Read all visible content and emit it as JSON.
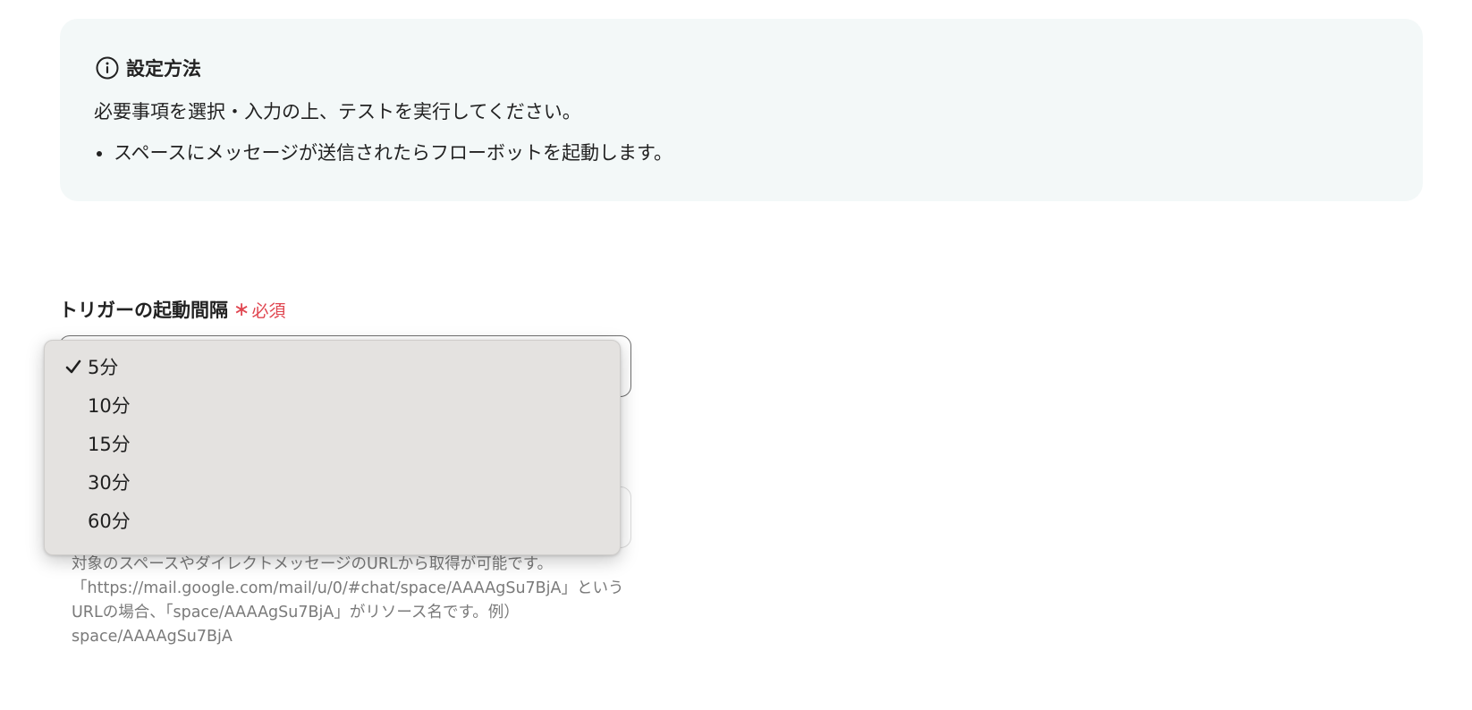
{
  "info": {
    "title": "設定方法",
    "description": "必要事項を選択・入力の上、テストを実行してください。",
    "bullets": [
      "スペースにメッセージが送信されたらフローボットを起動します。"
    ]
  },
  "trigger_interval": {
    "label": "トリガーの起動間隔",
    "required_mark": "∗",
    "required_text": "必須",
    "selected": "5分",
    "options": [
      "5分",
      "10分",
      "15分",
      "30分",
      "60分"
    ]
  },
  "resource_field": {
    "help_lines": [
      "対象のスペースやダイレクトメッセージのURLから取得が可能です。",
      "「https://mail.google.com/mail/u/0/#chat/space/AAAAgSu7BjA」という",
      "URLの場合、「space/AAAAgSu7BjA」がリソース名です。例）",
      "space/AAAAgSu7BjA"
    ]
  },
  "icons": {
    "info": "info-circle-icon",
    "check": "checkmark-icon"
  },
  "colors": {
    "info_background": "#f3f8f8",
    "required": "#e0454f",
    "dropdown_background": "#e4e2e0"
  }
}
